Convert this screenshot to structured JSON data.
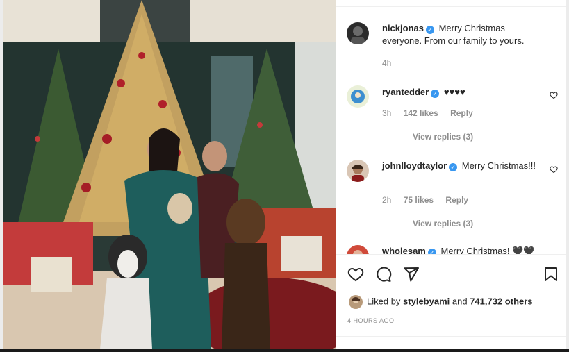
{
  "post": {
    "image_alt": "Family Christmas photo in front of decorated trees with dogs",
    "image_icon": "photo-christmas-family"
  },
  "comments": [
    {
      "username": "nickjonas",
      "verified": true,
      "text": "Merry Christmas everyone. From our family to yours.",
      "time": "4h",
      "likes": "",
      "reply": "",
      "view_replies": ""
    },
    {
      "username": "ryantedder",
      "verified": true,
      "text": "♥♥♥♥",
      "time": "3h",
      "likes": "142 likes",
      "reply": "Reply",
      "view_replies": "View replies (3)"
    },
    {
      "username": "johnlloydtaylor",
      "verified": true,
      "text": "Merry Christmas!!!",
      "time": "2h",
      "likes": "75 likes",
      "reply": "Reply",
      "view_replies": "View replies (3)"
    },
    {
      "username": "wholesam",
      "verified": true,
      "text": "Merry Christmas! 🖤🖤🖤",
      "time": "",
      "likes": "",
      "reply": "",
      "view_replies": ""
    }
  ],
  "actions": {
    "like_icon": "heart-icon",
    "comment_icon": "comment-icon",
    "share_icon": "share-icon",
    "save_icon": "bookmark-icon"
  },
  "likes": {
    "prefix": "Liked by",
    "user": "stylebyami",
    "and": "and",
    "count": "741,732 others"
  },
  "timestamp": "4 HOURS AGO",
  "colors": {
    "verified": "#3897f0",
    "text": "#262626",
    "muted": "#8e8e8e"
  }
}
